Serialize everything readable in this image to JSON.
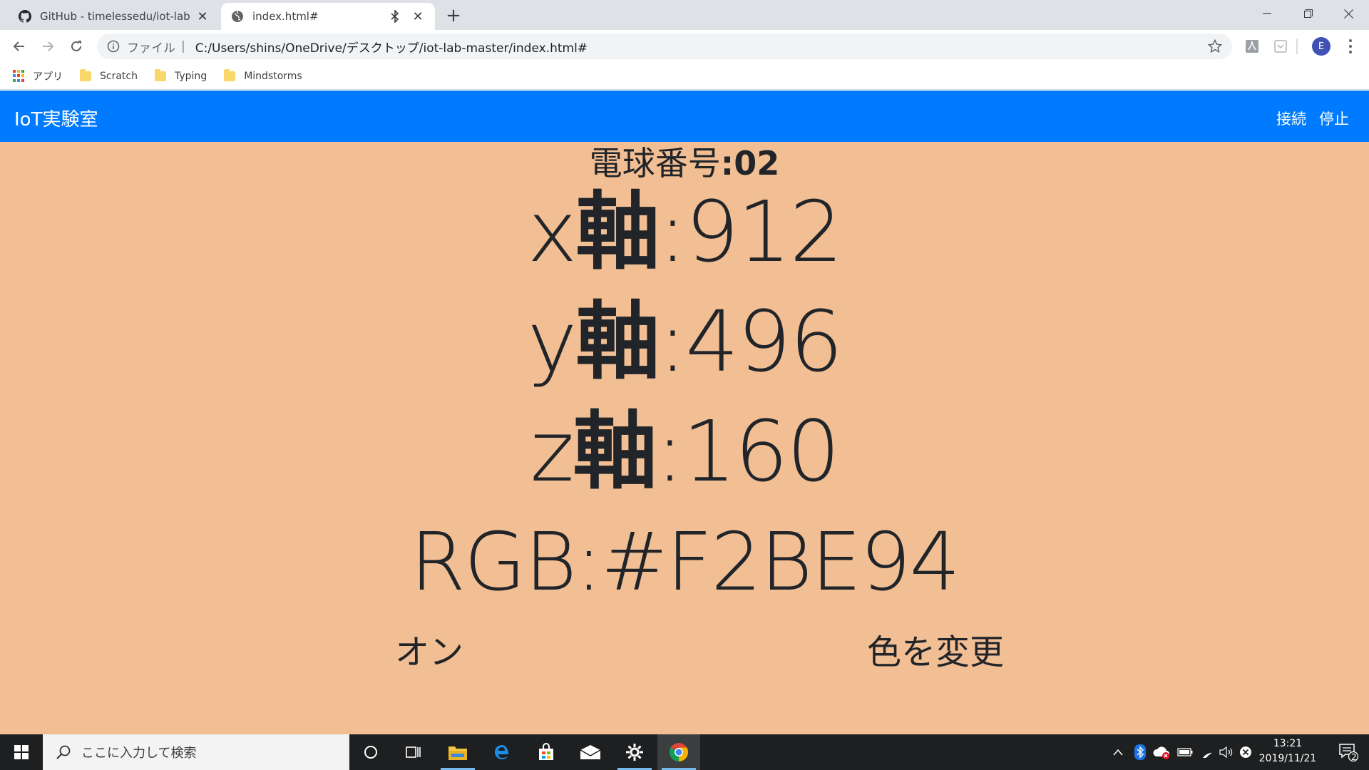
{
  "browser": {
    "tabs": [
      {
        "title": "GitHub - timelessedu/iot-lab",
        "active": false
      },
      {
        "title": "index.html#",
        "active": true
      }
    ],
    "new_tab_label": "+",
    "address": {
      "scheme_label": "ファイル",
      "separator": "|",
      "url": "C:/Users/shins/OneDrive/デスクトップ/iot-lab-master/index.html#"
    },
    "profile_initial": "E",
    "bookmarks": [
      {
        "label": "アプリ",
        "icon": "apps-grid-icon"
      },
      {
        "label": "Scratch",
        "icon": "folder-icon"
      },
      {
        "label": "Typing",
        "icon": "folder-icon"
      },
      {
        "label": "Mindstorms",
        "icon": "folder-icon"
      }
    ]
  },
  "app": {
    "brand": "IoT実験室",
    "nav": {
      "connect": "接続",
      "stop": "停止"
    },
    "bulb_label": "電球番号",
    "bulb_sep": ":",
    "bulb_number": "02",
    "axes": [
      {
        "axis": "x",
        "kanji": "軸",
        "value": ":912"
      },
      {
        "axis": "y",
        "kanji": "軸",
        "value": ":496"
      },
      {
        "axis": "z",
        "kanji": "軸",
        "value": ":160"
      }
    ],
    "rgb": "RGB:#F2BE94",
    "on_button": "オン",
    "change_color_button": "色を変更",
    "background_color": "#f2be94",
    "navbar_color": "#007bff"
  },
  "taskbar": {
    "search_placeholder": "ここに入力して検索",
    "time": "13:21",
    "date": "2019/11/21",
    "notification_count": "2"
  }
}
